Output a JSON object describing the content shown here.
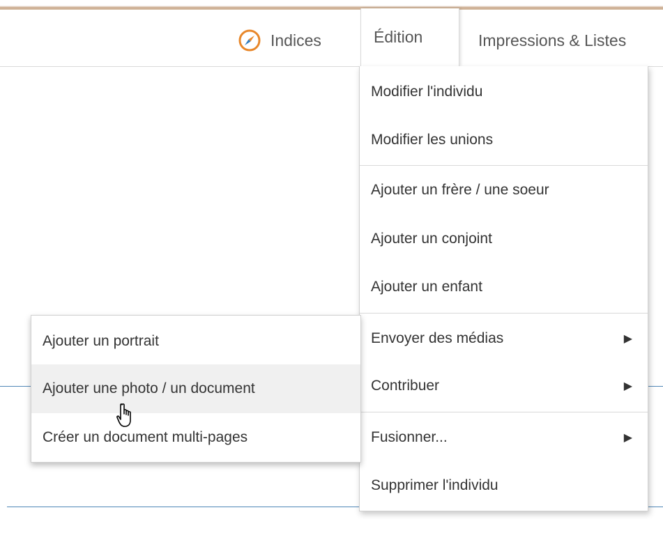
{
  "navbar": {
    "indices_label": "Indices",
    "edition_label": "Édition",
    "print_label": "Impressions & Listes"
  },
  "edition_menu": {
    "items": [
      {
        "label": "Modifier l'individu"
      },
      {
        "label": "Modifier les unions"
      },
      {
        "label": "Ajouter un frère / une soeur"
      },
      {
        "label": "Ajouter un conjoint"
      },
      {
        "label": "Ajouter un enfant"
      },
      {
        "label": "Envoyer des médias",
        "arrow": "▶"
      },
      {
        "label": "Contribuer",
        "arrow": "▶"
      },
      {
        "label": "Fusionner...",
        "arrow": "▶"
      },
      {
        "label": "Supprimer l'individu"
      }
    ]
  },
  "media_submenu": {
    "items": [
      {
        "label": "Ajouter un portrait"
      },
      {
        "label": "Ajouter une photo / un document"
      },
      {
        "label": "Créer un document multi-pages"
      }
    ],
    "hovered": "Ajouter une photo / un document"
  },
  "icons": {
    "indices": "compass-icon",
    "submenu_arrow": "triangle-right-icon",
    "cursor": "hand-pointer-icon"
  },
  "colors": {
    "accent_orange": "#e8872a",
    "line_blue": "#4f86b7",
    "hover_bg": "#f0f0f0"
  }
}
